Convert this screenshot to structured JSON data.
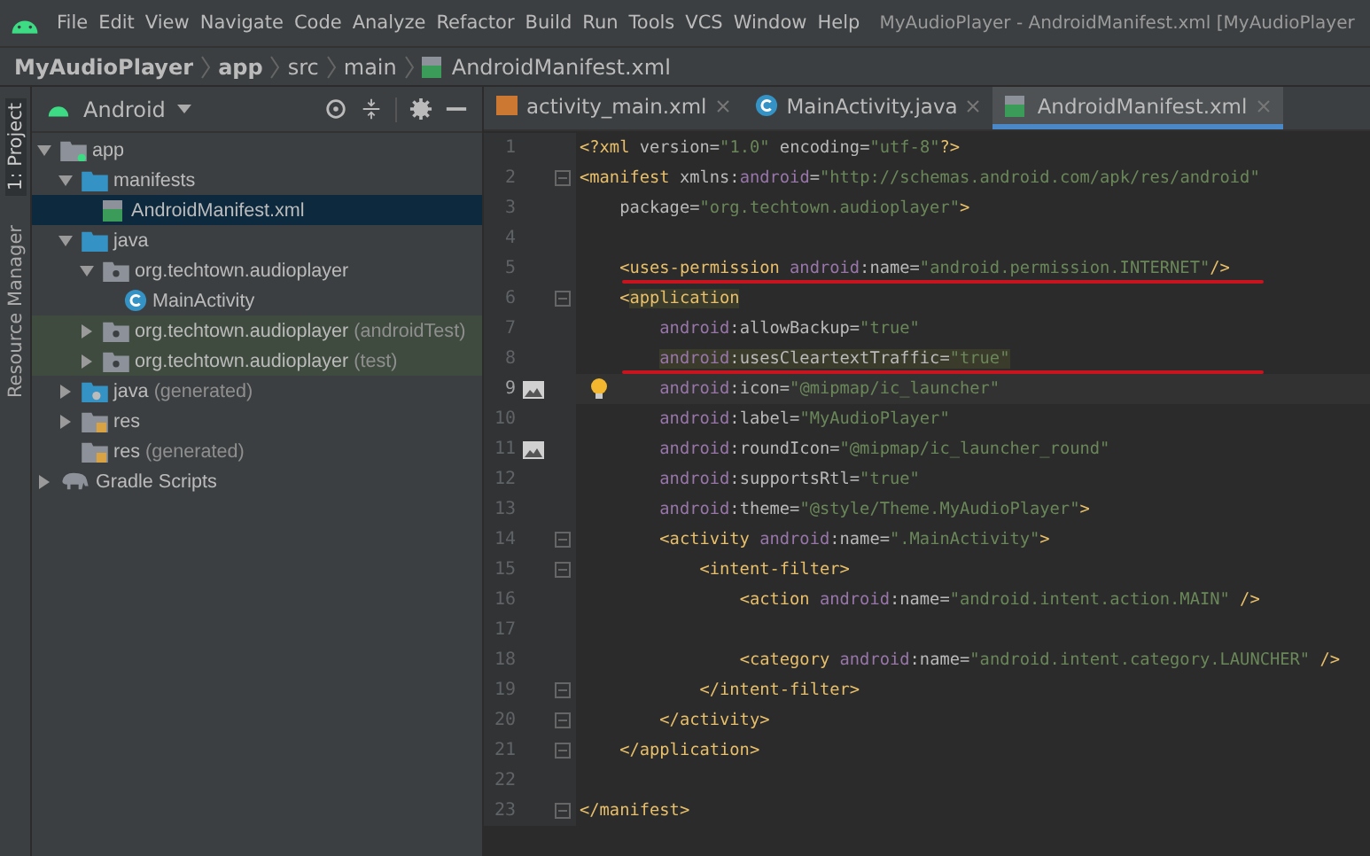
{
  "menu_bar": {
    "items": [
      "File",
      "Edit",
      "View",
      "Navigate",
      "Code",
      "Analyze",
      "Refactor",
      "Build",
      "Run",
      "Tools",
      "VCS",
      "Window",
      "Help"
    ],
    "title": "MyAudioPlayer - AndroidManifest.xml [MyAudioPlayer"
  },
  "breadcrumb": [
    {
      "label": "MyAudioPlayer",
      "kind": "project"
    },
    {
      "label": "app",
      "kind": "module"
    },
    {
      "label": "src",
      "kind": "folder"
    },
    {
      "label": "main",
      "kind": "folder"
    },
    {
      "label": "AndroidManifest.xml",
      "kind": "manifest"
    }
  ],
  "side_strip": [
    {
      "label": "1: Project",
      "selected": true
    },
    {
      "label": "Resource Manager",
      "selected": false
    }
  ],
  "project_panel": {
    "view": "Android"
  },
  "project_tree": [
    {
      "label": "app",
      "kind": "module",
      "expanded": true,
      "selected": false,
      "children": [
        {
          "label": "manifests",
          "kind": "folder",
          "expanded": true,
          "selected": false,
          "children": [
            {
              "label": "AndroidManifest.xml",
              "kind": "manifest",
              "selected": true
            }
          ]
        },
        {
          "label": "java",
          "kind": "folder",
          "expanded": true,
          "selected": false,
          "children": [
            {
              "label": "org.techtown.audioplayer",
              "kind": "package",
              "expanded": true,
              "selected": false,
              "children": [
                {
                  "label": "MainActivity",
                  "kind": "class",
                  "selected": false
                }
              ]
            },
            {
              "label": "org.techtown.audioplayer",
              "note": "(androidTest)",
              "kind": "package",
              "expanded": false,
              "selected": false,
              "test": true
            },
            {
              "label": "org.techtown.audioplayer",
              "note": "(test)",
              "kind": "package",
              "expanded": false,
              "selected": false,
              "test": true
            }
          ]
        },
        {
          "label": "java",
          "note": "(generated)",
          "kind": "generated",
          "expanded": false,
          "selected": false
        },
        {
          "label": "res",
          "kind": "res",
          "expanded": false,
          "selected": false
        },
        {
          "label": "res",
          "note": "(generated)",
          "kind": "res",
          "selected": false
        }
      ]
    },
    {
      "label": "Gradle Scripts",
      "kind": "gradle",
      "expanded": false,
      "selected": false
    }
  ],
  "editor_tabs": [
    {
      "label": "activity_main.xml",
      "kind": "layout",
      "selected": false
    },
    {
      "label": "MainActivity.java",
      "kind": "class",
      "selected": false
    },
    {
      "label": "AndroidManifest.xml",
      "kind": "manifest",
      "selected": true
    }
  ],
  "code_lines": [
    {
      "number": "1",
      "tokens": [
        {
          "text": "<?xml",
          "kind": "tag"
        },
        {
          "text": " version=",
          "kind": "attr"
        },
        {
          "text": "\"1.0\"",
          "kind": "str"
        },
        {
          "text": " encoding=",
          "kind": "attr"
        },
        {
          "text": "\"utf-8\"",
          "kind": "str"
        },
        {
          "text": "?>",
          "kind": "tag"
        }
      ]
    },
    {
      "number": "2",
      "fold": true,
      "tokens": [
        {
          "text": "<manifest",
          "kind": "tag"
        },
        {
          "text": " xmlns:",
          "kind": "attr"
        },
        {
          "text": "android",
          "kind": "ns"
        },
        {
          "text": "=",
          "kind": "attr"
        },
        {
          "text": "\"http://schemas.android.com/apk/res/android\"",
          "kind": "str"
        }
      ]
    },
    {
      "number": "3",
      "tokens": [
        {
          "text": "    package=",
          "kind": "attr"
        },
        {
          "text": "\"org.techtown.audioplayer\"",
          "kind": "str"
        },
        {
          "text": ">",
          "kind": "tag"
        }
      ]
    },
    {
      "number": "4"
    },
    {
      "number": "5",
      "red_underline": true,
      "tokens": [
        {
          "text": "    <uses-permission ",
          "kind": "tag"
        },
        {
          "text": "android",
          "kind": "ns"
        },
        {
          "text": ":name=",
          "kind": "attr"
        },
        {
          "text": "\"android.permission.INTERNET\"",
          "kind": "str"
        },
        {
          "text": "/>",
          "kind": "tag"
        }
      ]
    },
    {
      "number": "6",
      "fold": true,
      "tokens": [
        {
          "text": "    <",
          "kind": "tag"
        },
        {
          "text": "application",
          "kind": "tag",
          "highlight": true
        }
      ]
    },
    {
      "number": "7",
      "tokens": [
        {
          "text": "        android",
          "kind": "ns"
        },
        {
          "text": ":allowBackup=",
          "kind": "attr"
        },
        {
          "text": "\"true\"",
          "kind": "str"
        }
      ]
    },
    {
      "number": "8",
      "red_underline": true,
      "tokens": [
        {
          "text": "        android",
          "kind": "ns",
          "highlight": true
        },
        {
          "text": ":usesCleartextTraffic=",
          "kind": "attr",
          "highlight": true
        },
        {
          "text": "\"true\"",
          "kind": "str",
          "highlight": true
        }
      ]
    },
    {
      "number": "9",
      "current": true,
      "image_icon": true,
      "bulb": true,
      "tokens": [
        {
          "text": "        android",
          "kind": "ns"
        },
        {
          "text": ":icon=",
          "kind": "attr"
        },
        {
          "text": "\"@mipmap/ic_launcher\"",
          "kind": "str"
        }
      ]
    },
    {
      "number": "10",
      "tokens": [
        {
          "text": "        android",
          "kind": "ns"
        },
        {
          "text": ":label=",
          "kind": "attr"
        },
        {
          "text": "\"MyAudioPlayer\"",
          "kind": "str"
        }
      ]
    },
    {
      "number": "11",
      "image_icon": true,
      "tokens": [
        {
          "text": "        android",
          "kind": "ns"
        },
        {
          "text": ":roundIcon=",
          "kind": "attr"
        },
        {
          "text": "\"@mipmap/ic_launcher_round\"",
          "kind": "str"
        }
      ]
    },
    {
      "number": "12",
      "tokens": [
        {
          "text": "        android",
          "kind": "ns"
        },
        {
          "text": ":supportsRtl=",
          "kind": "attr"
        },
        {
          "text": "\"true\"",
          "kind": "str"
        }
      ]
    },
    {
      "number": "13",
      "tokens": [
        {
          "text": "        android",
          "kind": "ns"
        },
        {
          "text": ":theme=",
          "kind": "attr"
        },
        {
          "text": "\"@style/Theme.MyAudioPlayer\"",
          "kind": "str"
        },
        {
          "text": ">",
          "kind": "tag"
        }
      ]
    },
    {
      "number": "14",
      "fold": true,
      "tokens": [
        {
          "text": "        <activity ",
          "kind": "tag"
        },
        {
          "text": "android",
          "kind": "ns"
        },
        {
          "text": ":name=",
          "kind": "attr"
        },
        {
          "text": "\".MainActivity\"",
          "kind": "str"
        },
        {
          "text": ">",
          "kind": "tag"
        }
      ]
    },
    {
      "number": "15",
      "fold": true,
      "tokens": [
        {
          "text": "            <intent-filter>",
          "kind": "tag"
        }
      ]
    },
    {
      "number": "16",
      "tokens": [
        {
          "text": "                <action ",
          "kind": "tag"
        },
        {
          "text": "android",
          "kind": "ns"
        },
        {
          "text": ":name=",
          "kind": "attr"
        },
        {
          "text": "\"android.intent.action.MAIN\"",
          "kind": "str"
        },
        {
          "text": " />",
          "kind": "tag"
        }
      ]
    },
    {
      "number": "17"
    },
    {
      "number": "18",
      "tokens": [
        {
          "text": "                <category ",
          "kind": "tag"
        },
        {
          "text": "android",
          "kind": "ns"
        },
        {
          "text": ":name=",
          "kind": "attr"
        },
        {
          "text": "\"android.intent.category.LAUNCHER\"",
          "kind": "str"
        },
        {
          "text": " />",
          "kind": "tag"
        }
      ]
    },
    {
      "number": "19",
      "fold": true,
      "tokens": [
        {
          "text": "            </intent-filter>",
          "kind": "tag"
        }
      ]
    },
    {
      "number": "20",
      "fold": true,
      "tokens": [
        {
          "text": "        </activity>",
          "kind": "tag"
        }
      ]
    },
    {
      "number": "21",
      "fold": true,
      "tokens": [
        {
          "text": "    </application>",
          "kind": "tag"
        }
      ]
    },
    {
      "number": "22"
    },
    {
      "number": "23",
      "fold": true,
      "tokens": [
        {
          "text": "</manifest>",
          "kind": "tag"
        }
      ]
    }
  ]
}
